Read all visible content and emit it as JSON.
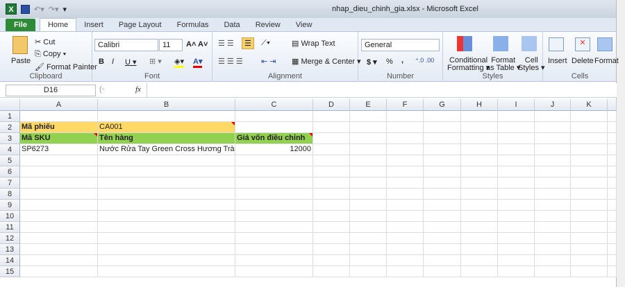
{
  "window": {
    "title": "nhap_dieu_chinh_gia.xlsx  -  Microsoft Excel"
  },
  "tabs": [
    "File",
    "Home",
    "Insert",
    "Page Layout",
    "Formulas",
    "Data",
    "Review",
    "View"
  ],
  "ribbon": {
    "clipboard": {
      "label": "Clipboard",
      "paste": "Paste",
      "cut": "Cut",
      "copy": "Copy",
      "format_painter": "Format Painter"
    },
    "font": {
      "label": "Font",
      "name": "Calibri",
      "size": "11"
    },
    "alignment": {
      "label": "Alignment",
      "wrap": "Wrap Text",
      "merge": "Merge & Center"
    },
    "number": {
      "label": "Number",
      "format": "General",
      "currency": "$",
      "percent": "%",
      "comma": ","
    },
    "styles": {
      "label": "Styles",
      "conditional": [
        "Conditional",
        "Formatting"
      ],
      "format_table": [
        "Format",
        "as Table"
      ],
      "cell_styles": [
        "Cell",
        "Styles"
      ]
    },
    "cells": {
      "label": "Cells",
      "insert": "Insert",
      "delete": "Delete",
      "format": "Format"
    }
  },
  "formula_bar": {
    "name_box": "D16",
    "fx": "fx",
    "value": ""
  },
  "columns": [
    "A",
    "B",
    "C",
    "D",
    "E",
    "F",
    "G",
    "H",
    "I",
    "J",
    "K"
  ],
  "rows": [
    "1",
    "2",
    "3",
    "4",
    "5",
    "6",
    "7",
    "8",
    "9",
    "10",
    "11",
    "12",
    "13",
    "14",
    "15"
  ],
  "cells": {
    "A2": "Mã phiếu",
    "B2": "CA001",
    "A3": "Mã SKU",
    "B3": "Tên hàng",
    "C3": "Giá vốn điều chỉnh",
    "A4": "SP6273",
    "B4": "Nước Rửa Tay Green Cross Hương Trà Xanh",
    "C4": "12000"
  },
  "colors": {
    "yellow": "#ffd966",
    "green": "#92d050",
    "comment": "#e00000"
  }
}
